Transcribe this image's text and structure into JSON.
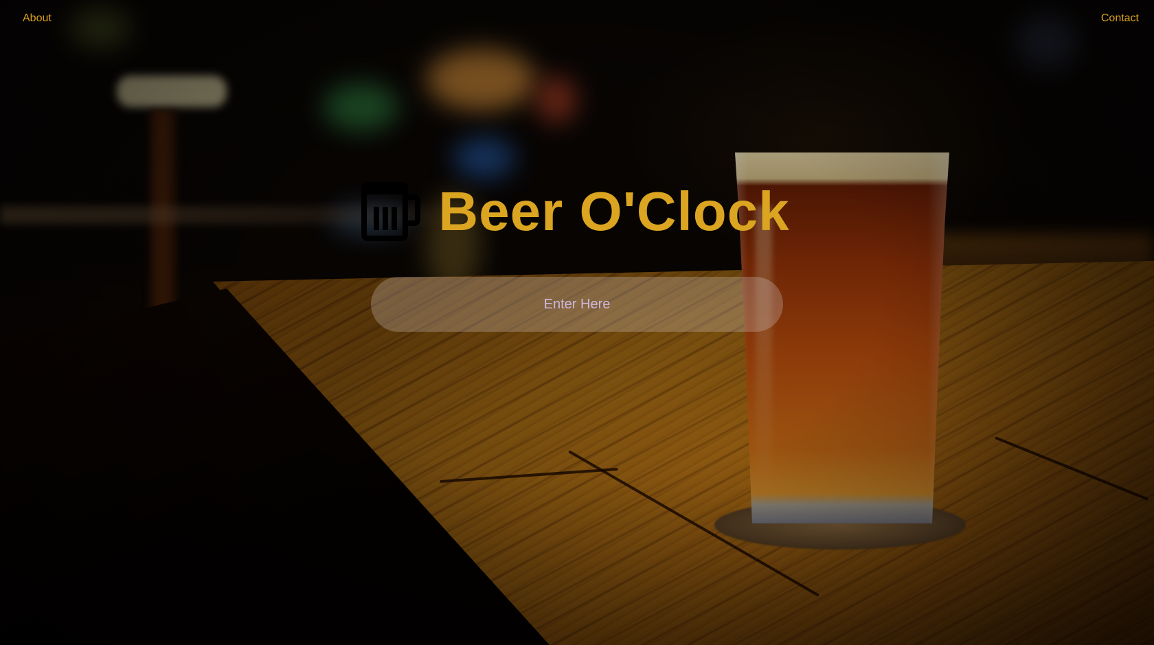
{
  "nav": {
    "about_label": "About",
    "contact_label": "Contact"
  },
  "hero": {
    "icon": "beer-mug-icon",
    "title": "Beer O'Clock"
  },
  "cta": {
    "enter_label": "Enter Here"
  },
  "colors": {
    "accent": "#dba521",
    "button_text": "#cfb8dc",
    "icon": "#000000"
  }
}
